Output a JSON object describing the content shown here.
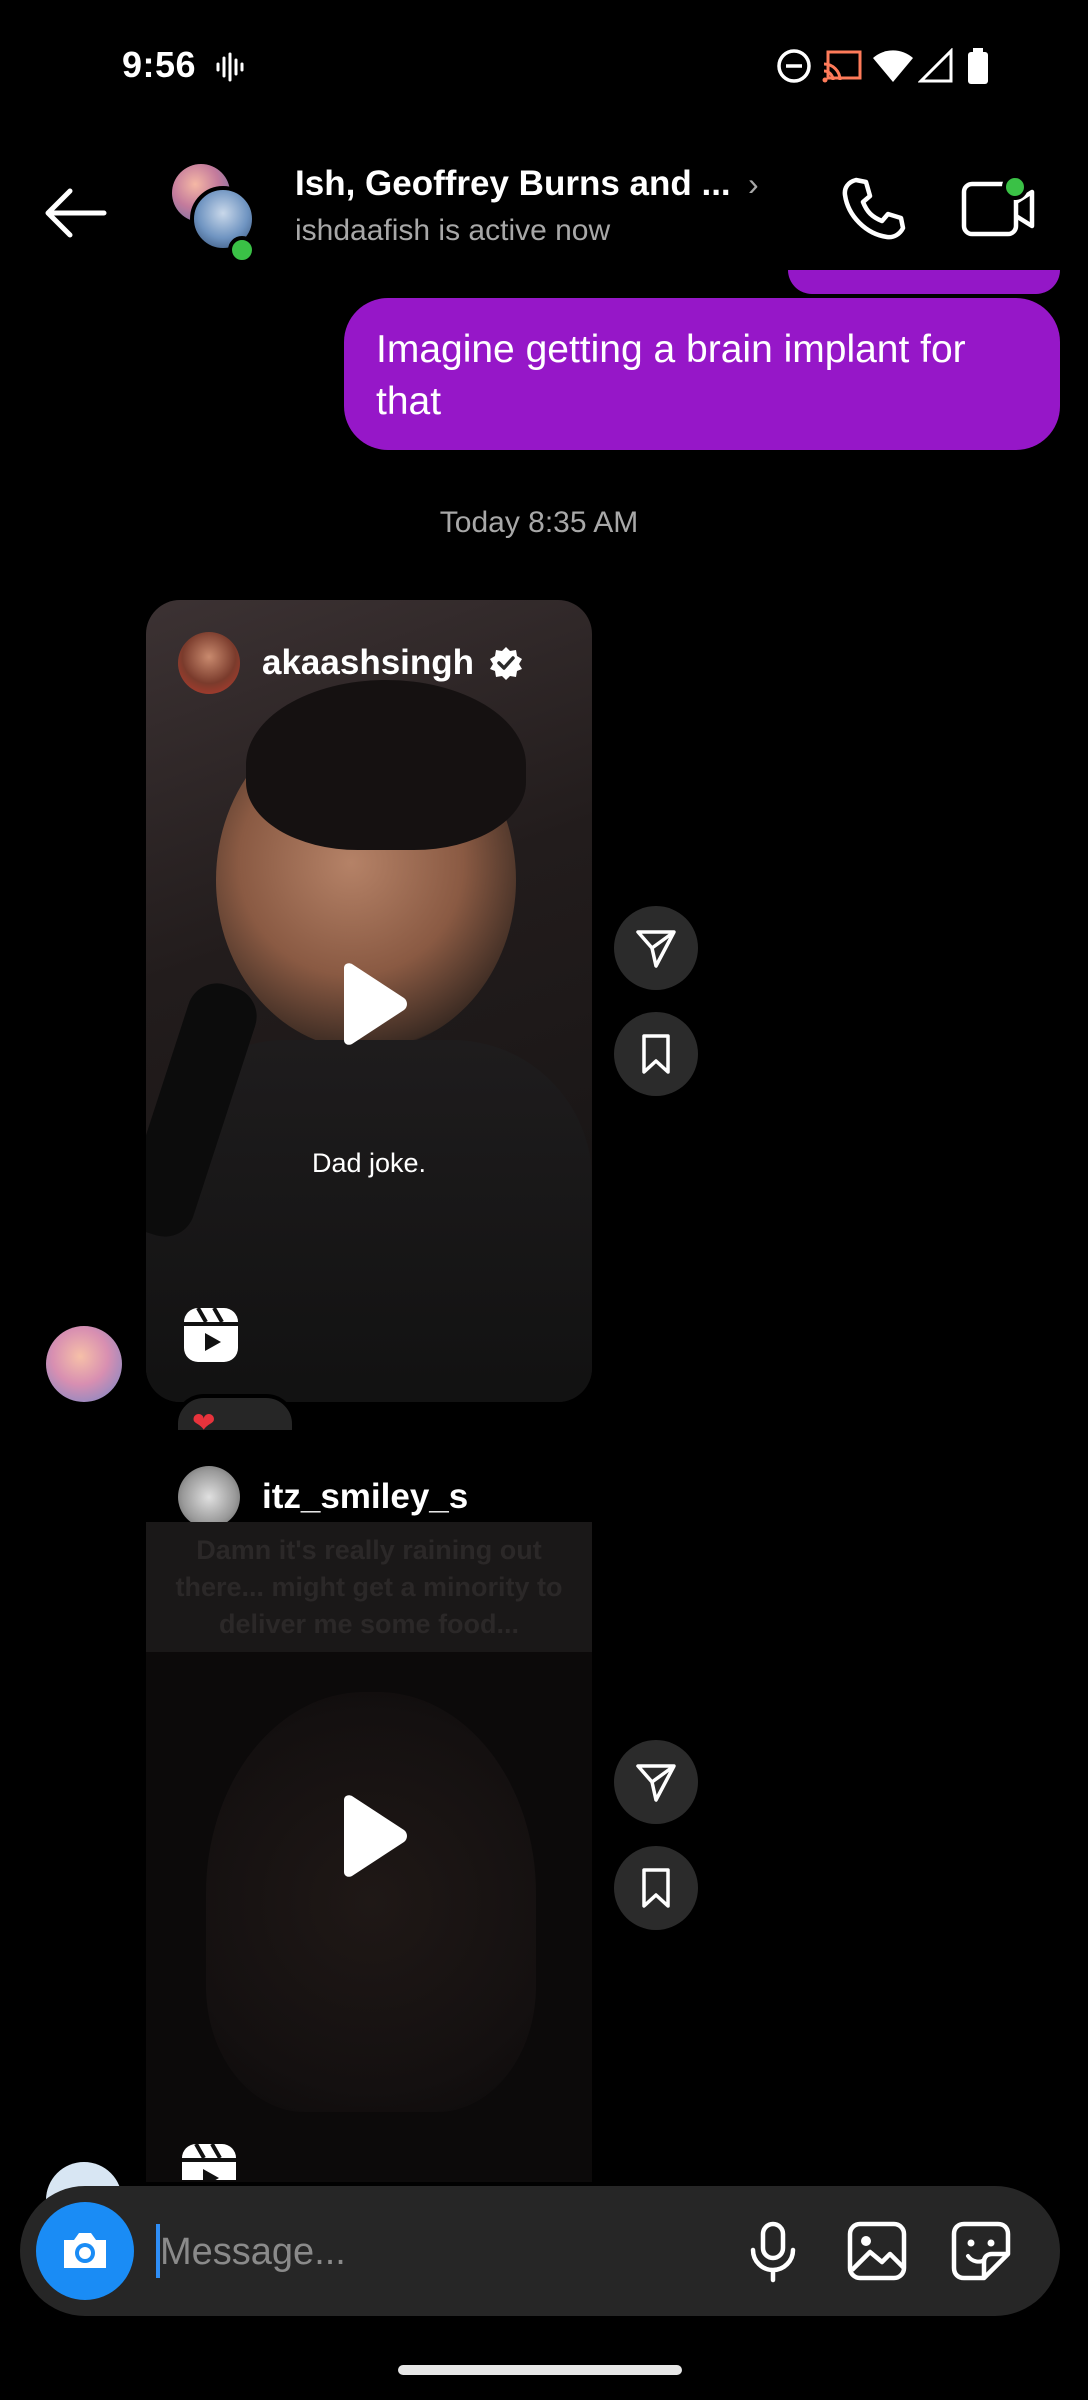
{
  "status_bar": {
    "time": "9:56"
  },
  "header": {
    "title": "Ish, Geoffrey Burns and ...",
    "subtitle": "ishdaafish is active now"
  },
  "messages": {
    "outgoing_text": "Imagine getting a brain implant for that",
    "timestamp": "Today 8:35 AM"
  },
  "reel1": {
    "username": "akaashsingh",
    "caption": "Dad joke.",
    "reaction": "❤"
  },
  "reel2": {
    "username": "itz_smiley_s",
    "overlay_text": "Damn it's really raining out there... might get a minority to deliver me some food..."
  },
  "composer": {
    "placeholder": "Message..."
  },
  "colors": {
    "outgoing_bubble": "#9617c8",
    "online": "#3ac146",
    "camera_button": "#1a8cf5"
  }
}
